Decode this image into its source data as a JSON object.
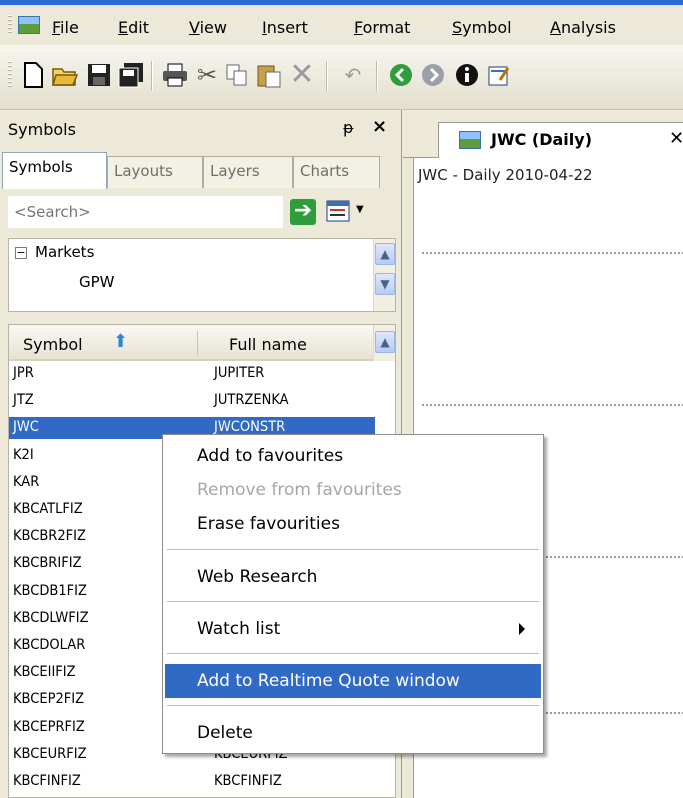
{
  "menubar": {
    "items": [
      "File",
      "Edit",
      "View",
      "Insert",
      "Format",
      "Symbol",
      "Analysis"
    ]
  },
  "toolbar": {
    "icons": [
      "new-document-icon",
      "open-folder-icon",
      "save-icon",
      "save-all-icon",
      "print-icon",
      "cut-icon",
      "copy-icon",
      "paste-icon",
      "delete-icon",
      "undo-icon",
      "back-icon",
      "forward-icon",
      "info-icon",
      "edit-icon"
    ]
  },
  "symbols_panel": {
    "title": "Symbols",
    "tabs": [
      "Symbols",
      "Layouts",
      "Layers",
      "Charts"
    ],
    "active_tab": "Symbols",
    "search": {
      "placeholder": "<Search>"
    },
    "tree": {
      "root": "Markets",
      "child": "GPW"
    },
    "table": {
      "columns": [
        "Symbol",
        "Full name"
      ],
      "rows": [
        {
          "symbol": "JPR",
          "full_name": "JUPITER"
        },
        {
          "symbol": "JTZ",
          "full_name": "JUTRZENKA"
        },
        {
          "symbol": "JWC",
          "full_name": "JWCONSTR",
          "selected": true
        },
        {
          "symbol": "K2I",
          "full_name": ""
        },
        {
          "symbol": "KAR",
          "full_name": ""
        },
        {
          "symbol": "KBCATLFIZ",
          "full_name": ""
        },
        {
          "symbol": "KBCBR2FIZ",
          "full_name": ""
        },
        {
          "symbol": "KBCBRIFIZ",
          "full_name": ""
        },
        {
          "symbol": "KBCDB1FIZ",
          "full_name": ""
        },
        {
          "symbol": "KBCDLWFIZ",
          "full_name": ""
        },
        {
          "symbol": "KBCDOLAR",
          "full_name": ""
        },
        {
          "symbol": "KBCEIIFIZ",
          "full_name": ""
        },
        {
          "symbol": "KBCEP2FIZ",
          "full_name": ""
        },
        {
          "symbol": "KBCEPRFIZ",
          "full_name": ""
        },
        {
          "symbol": "KBCEURFIZ",
          "full_name": "KBCEURFIZ"
        },
        {
          "symbol": "KBCFINFIZ",
          "full_name": "KBCFINFIZ"
        }
      ]
    }
  },
  "chart": {
    "tab_title": "JWC (Daily)",
    "caption": "JWC - Daily 2010-04-22"
  },
  "context_menu": {
    "items": [
      {
        "label": "Add to favourites",
        "enabled": true
      },
      {
        "label": "Remove from favourites",
        "enabled": false
      },
      {
        "label": "Erase favourities",
        "enabled": true
      },
      {
        "label": "Web Research",
        "enabled": true
      },
      {
        "label": "Watch list",
        "enabled": true,
        "submenu": true
      },
      {
        "label": "Add to Realtime Quote window",
        "enabled": true,
        "highlighted": true
      },
      {
        "label": "Delete",
        "enabled": true
      }
    ]
  },
  "colors": {
    "selection": "#316ac5",
    "title_accent": "#2a6ad6",
    "chrome": "#ece9d8"
  }
}
